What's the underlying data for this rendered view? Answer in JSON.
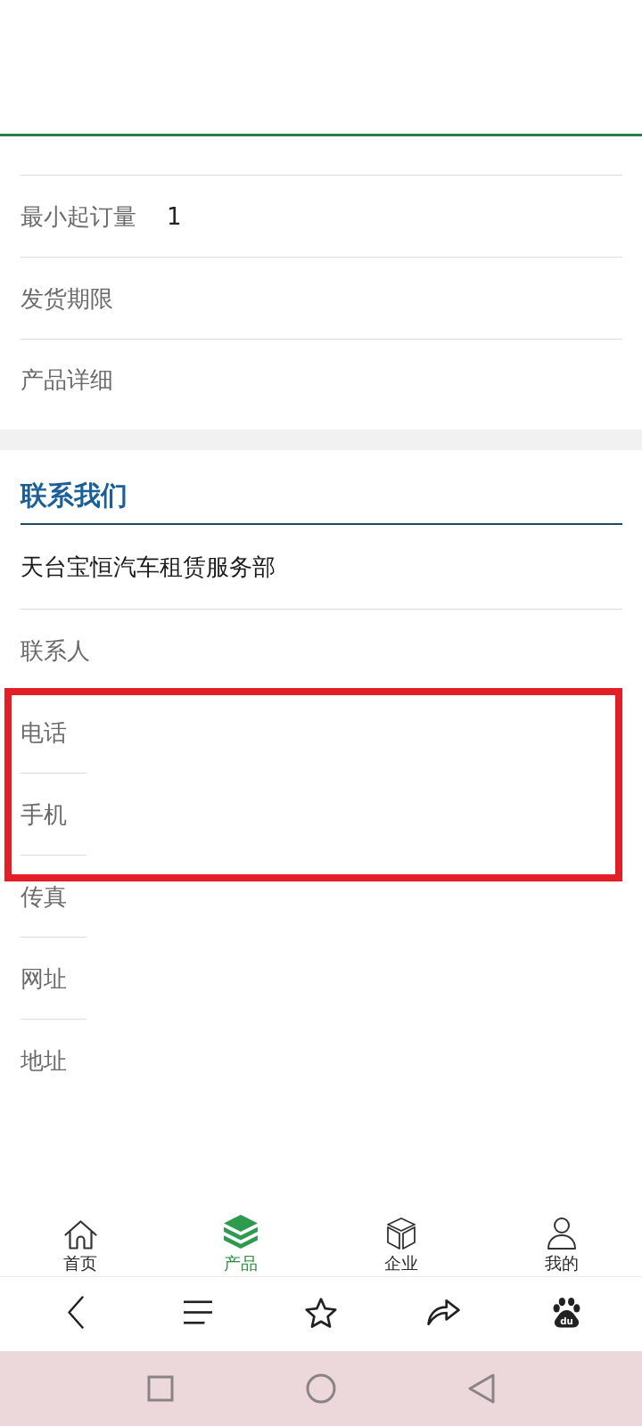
{
  "product_info": [
    {
      "label": "最小起订量",
      "value": "1"
    },
    {
      "label": "发货期限"
    },
    {
      "label": "产品详细"
    }
  ],
  "contact": {
    "title": "联系我们",
    "company": "天台宝恒汽车租赁服务部",
    "fields": [
      {
        "label": "联系人",
        "highlighted": false
      },
      {
        "label": "电话",
        "highlighted": true
      },
      {
        "label": "手机",
        "highlighted": true
      },
      {
        "label": "传真",
        "highlighted": false
      },
      {
        "label": "网址",
        "highlighted": false
      },
      {
        "label": "地址",
        "highlighted": false
      }
    ]
  },
  "tab_bar": [
    {
      "kind": "home",
      "label": "首页",
      "selected": false
    },
    {
      "kind": "products",
      "label": "产品",
      "selected": true
    },
    {
      "kind": "company",
      "label": "企业",
      "selected": false
    },
    {
      "kind": "me",
      "label": "我的",
      "selected": false
    }
  ],
  "browser_toolbar": [
    {
      "kind": "back"
    },
    {
      "kind": "menu"
    },
    {
      "kind": "favorite"
    },
    {
      "kind": "share"
    },
    {
      "kind": "baidu",
      "logo_text": "du"
    }
  ],
  "system_nav": [
    {
      "kind": "recents"
    },
    {
      "kind": "home"
    },
    {
      "kind": "back"
    }
  ]
}
